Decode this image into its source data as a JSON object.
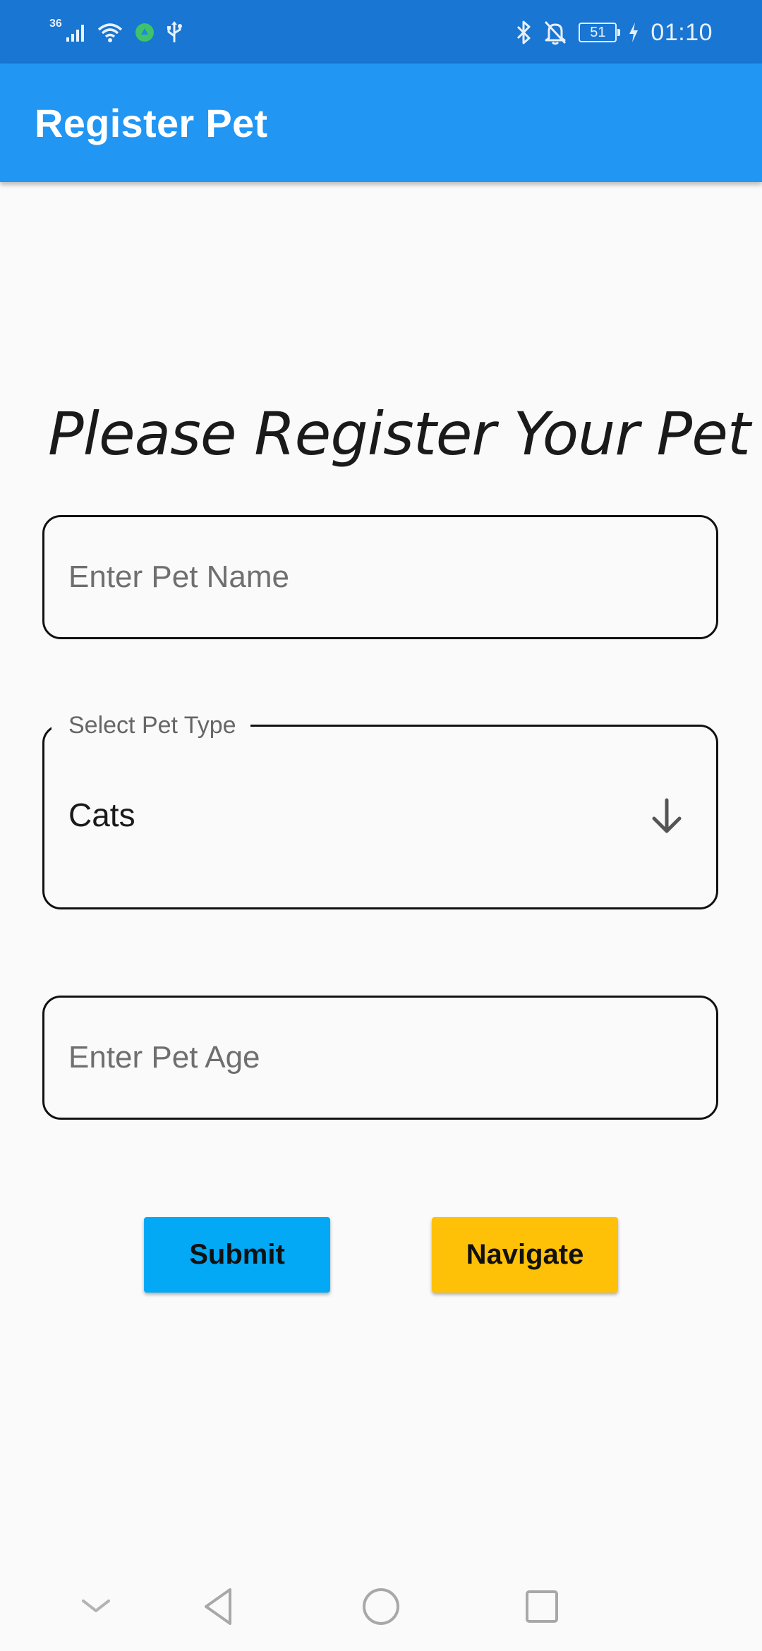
{
  "status_bar": {
    "network_label": "36",
    "battery_level": "51",
    "time": "01:10",
    "icons": [
      "signal-icon",
      "wifi-icon",
      "app-notification-icon",
      "usb-icon",
      "bluetooth-icon",
      "notifications-off-icon",
      "battery-icon",
      "charging-icon"
    ]
  },
  "app_bar": {
    "title": "Register Pet",
    "color": "#2196f3"
  },
  "form": {
    "heading": "Please Register Your Pet",
    "pet_name": {
      "value": "",
      "placeholder": "Enter Pet Name"
    },
    "pet_type": {
      "label": "Select Pet Type",
      "selected": "Cats",
      "icon": "arrow-down-icon"
    },
    "pet_age": {
      "value": "",
      "placeholder": "Enter Pet Age"
    }
  },
  "buttons": {
    "submit_label": "Submit",
    "submit_color": "#03a9f4",
    "navigate_label": "Navigate",
    "navigate_color": "#ffc107"
  },
  "nav_bar": {
    "icons": [
      "hide-nav-icon",
      "back-icon",
      "home-icon",
      "recents-icon"
    ]
  }
}
